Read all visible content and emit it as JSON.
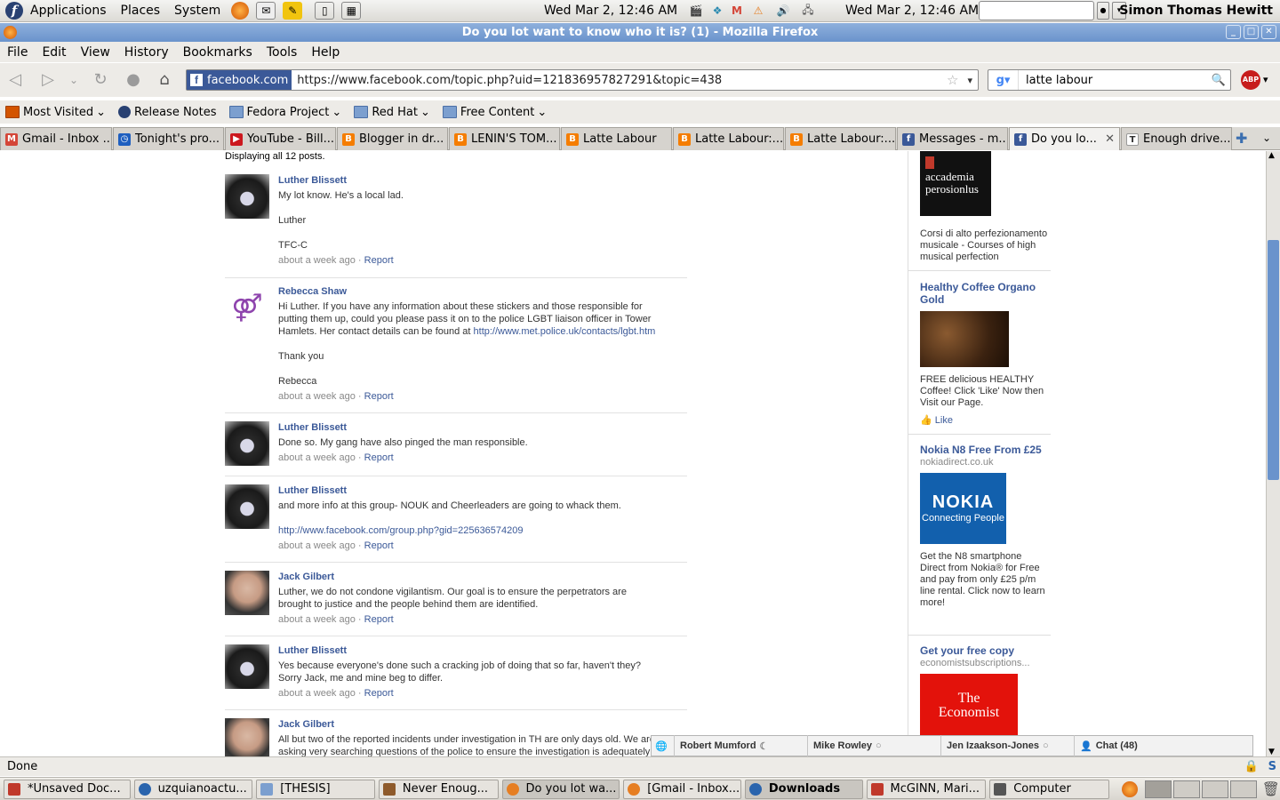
{
  "panel": {
    "menus": [
      "Applications",
      "Places",
      "System"
    ],
    "clock_left": "Wed Mar  2, 12:46 AM",
    "clock_right": "Wed Mar  2, 12:46 AM",
    "user": "Simon Thomas Hewitt"
  },
  "window": {
    "title": "Do you lot want to know who it is? (1) - Mozilla Firefox"
  },
  "menubar": [
    "File",
    "Edit",
    "View",
    "History",
    "Bookmarks",
    "Tools",
    "Help"
  ],
  "navbar": {
    "site_identity": "facebook.com",
    "url": "https://www.facebook.com/topic.php?uid=121836957827291&topic=438",
    "search_value": "latte labour",
    "abp_label": "ABP"
  },
  "bookmarks": [
    "Most Visited",
    "Release Notes",
    "Fedora Project",
    "Red Hat",
    "Free Content"
  ],
  "tabs": [
    {
      "label": "Gmail - Inbox ...",
      "color": "#d44638"
    },
    {
      "label": "Tonight's pro...",
      "color": "#1f5fbf"
    },
    {
      "label": "YouTube - Bill...",
      "color": "#cc181e"
    },
    {
      "label": "Blogger in dr...",
      "color": "#f57d00"
    },
    {
      "label": "LENIN'S TOM...",
      "color": "#f57d00"
    },
    {
      "label": "Latte Labour",
      "color": "#f57d00"
    },
    {
      "label": "Latte Labour:...",
      "color": "#f57d00"
    },
    {
      "label": "Latte Labour:...",
      "color": "#f57d00"
    },
    {
      "label": "Messages - m...",
      "color": "#3b5998"
    },
    {
      "label": "Do you lo...",
      "color": "#3b5998"
    },
    {
      "label": "Enough drive...",
      "color": "#555555"
    }
  ],
  "content": {
    "display_count": "Displaying all 12 posts.",
    "posts": [
      {
        "author": "Luther Blissett",
        "lines": [
          "My lot know. He's a local lad.",
          "",
          "Luther",
          "",
          "TFC-C"
        ],
        "time": "about a week ago",
        "report": "Report"
      },
      {
        "author": "Rebecca Shaw",
        "lines": [
          "Hi Luther. If you have any information about these stickers and those responsible for",
          "putting them up, could you please pass it on to the police LGBT liaison officer in Tower",
          "Hamlets. Her contact details can be found at "
        ],
        "link": "http://www.met.police.uk/contacts/lgbt.htm",
        "tail": [
          "",
          "Thank you",
          "",
          "Rebecca"
        ],
        "time": "about a week ago",
        "report": "Report"
      },
      {
        "author": "Luther Blissett",
        "lines": [
          "Done so. My gang have also pinged the man responsible."
        ],
        "time": "about a week ago",
        "report": "Report"
      },
      {
        "author": "Luther Blissett",
        "lines": [
          "and more info at this group- NOUK and Cheerleaders are going to whack them."
        ],
        "link": "http://www.facebook.com/group.php?gid=225636574209",
        "time": "about a week ago",
        "report": "Report"
      },
      {
        "author": "Jack Gilbert",
        "lines": [
          "Luther, we do not condone vigilantism. Our goal is to ensure the perpetrators are",
          "brought to justice and the people behind them are identified."
        ],
        "time": "about a week ago",
        "report": "Report"
      },
      {
        "author": "Luther Blissett",
        "lines": [
          "Yes because everyone's done such a cracking job of doing that so far, haven't they?",
          "Sorry Jack, me and mine beg to differ."
        ],
        "time": "about a week ago",
        "report": "Report"
      },
      {
        "author": "Jack Gilbert",
        "lines": [
          "All but two of the reported incidents under investigation in TH are only days old. We are",
          "asking very searching questions of the police to ensure the investigation is adequately"
        ]
      }
    ],
    "meta_sep": " · "
  },
  "ads": {
    "accademia": {
      "logo_line1": "accademia",
      "logo_line2": "perosionlus",
      "body": "Corsi di alto perfezionamento musicale - Courses of high musical perfection"
    },
    "coffee": {
      "title": "Healthy Coffee Organo Gold",
      "body": "FREE delicious HEALTHY Coffee! Click 'Like' Now then Visit our Page.",
      "like": "Like"
    },
    "nokia": {
      "title": "Nokia N8 Free From £25",
      "domain": "nokiadirect.co.uk",
      "logo": "NOKIA",
      "logo_sub": "Connecting People",
      "body": "Get the N8 smartphone Direct from Nokia® for Free and pay from only £25 p/m line rental. Click now to learn more!"
    },
    "economist": {
      "title": "Get your free copy",
      "domain": "economistsubscriptions...",
      "logo1": "The",
      "logo2": "Economist"
    }
  },
  "chat": {
    "contacts": [
      "Robert Mumford",
      "Mike Rowley",
      "Jen Izaakson-Jones"
    ],
    "chat_label": "Chat (48)"
  },
  "status": "Done",
  "taskbar": [
    {
      "label": "*Unsaved Doc...",
      "color": "#c0392b",
      "active": false
    },
    {
      "label": "uzquianoactu...",
      "color": "#2a64ad",
      "active": false
    },
    {
      "label": "[THESIS]",
      "color": "#7c9fcf",
      "active": false
    },
    {
      "label": "Never Enoug...",
      "color": "#8e5a2b",
      "active": false
    },
    {
      "label": "Do you lot wa...",
      "color": "#e67e22",
      "active": true
    },
    {
      "label": "[Gmail - Inbox...",
      "color": "#e67e22",
      "active": false
    },
    {
      "label": "Downloads",
      "color": "#2a64ad",
      "active": true
    },
    {
      "label": "McGINN, Mari...",
      "color": "#c0392b",
      "active": false
    },
    {
      "label": "Computer",
      "color": "#555555",
      "active": false
    }
  ]
}
